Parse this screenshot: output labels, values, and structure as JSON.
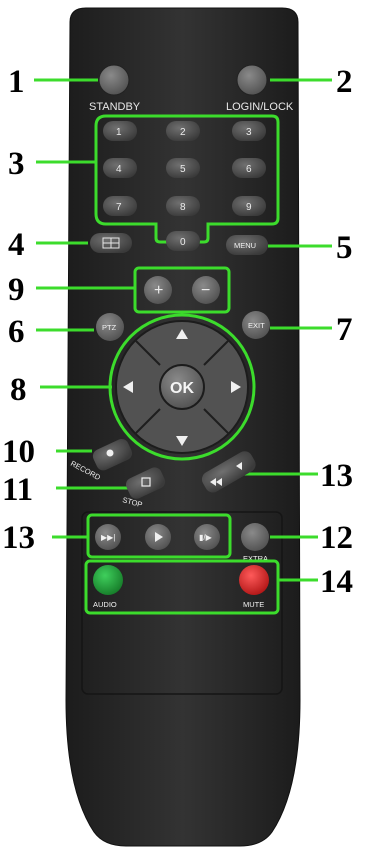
{
  "callouts": [
    "1",
    "2",
    "3",
    "4",
    "5",
    "6",
    "7",
    "8",
    "9",
    "10",
    "11",
    "12",
    "13",
    "13",
    "14"
  ],
  "labels": {
    "standby": "STANDBY",
    "login_lock": "LOGIN/LOCK",
    "menu": "MENU",
    "ptz": "PTZ",
    "exit": "EXIT",
    "ok": "OK",
    "record": "RECORD",
    "stop": "STOP",
    "extra": "EXTRA",
    "audio": "AUDIO",
    "mute": "MUTE",
    "plus": "+",
    "minus": "−"
  },
  "digits": [
    "1",
    "2",
    "3",
    "4",
    "5",
    "6",
    "7",
    "8",
    "9",
    "0"
  ],
  "colors": {
    "highlight": "#3cdc2c",
    "remote_body": "#2a2a2a",
    "button": "#4a4a4a",
    "audio_button": "#1f9a35",
    "mute_button": "#d42020"
  }
}
